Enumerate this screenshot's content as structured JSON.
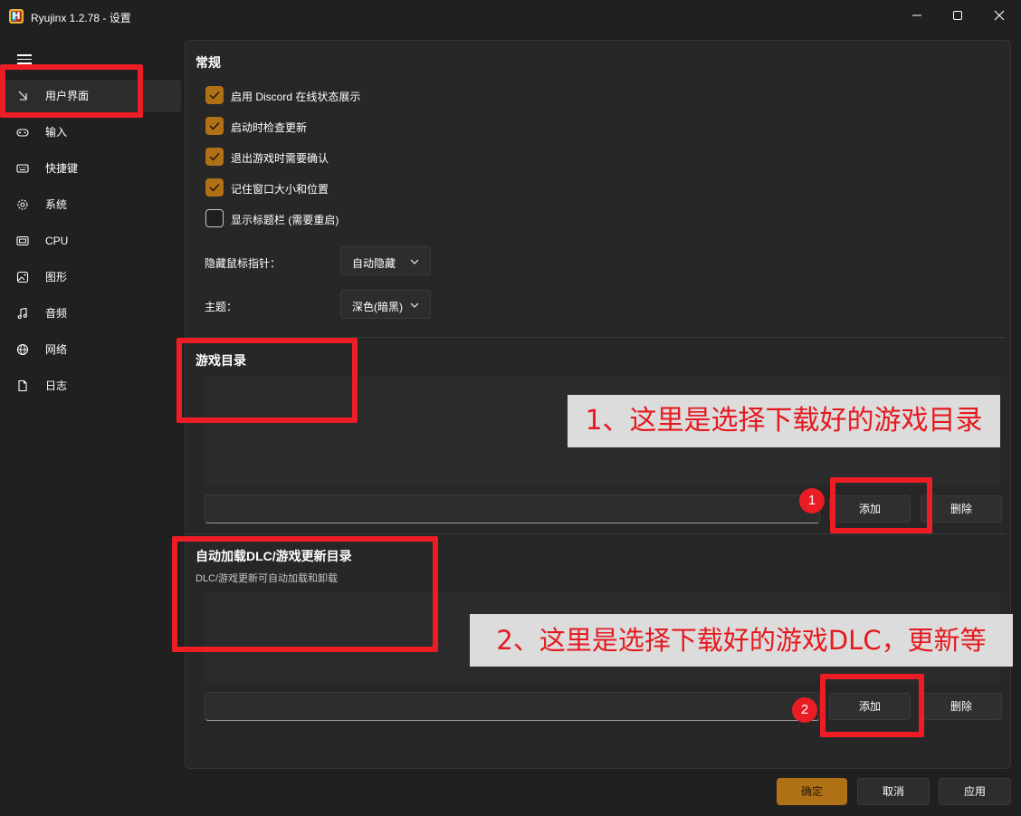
{
  "window": {
    "title": "Ryujinx 1.2.78 - 设置",
    "app_icon_letter": "H"
  },
  "sidebar": {
    "items": [
      {
        "label": "用户界面",
        "icon": "user-interface-icon",
        "active": true
      },
      {
        "label": "输入",
        "icon": "gamepad-icon"
      },
      {
        "label": "快捷键",
        "icon": "keyboard-icon"
      },
      {
        "label": "系统",
        "icon": "gear-icon"
      },
      {
        "label": "CPU",
        "icon": "cpu-icon"
      },
      {
        "label": "图形",
        "icon": "image-icon"
      },
      {
        "label": "音频",
        "icon": "music-note-icon"
      },
      {
        "label": "网络",
        "icon": "globe-icon"
      },
      {
        "label": "日志",
        "icon": "document-icon"
      }
    ]
  },
  "general": {
    "title": "常规",
    "checkboxes": [
      {
        "label": "启用 Discord 在线状态展示",
        "checked": true
      },
      {
        "label": "启动时检查更新",
        "checked": true
      },
      {
        "label": "退出游戏时需要确认",
        "checked": true
      },
      {
        "label": "记住窗口大小和位置",
        "checked": true
      },
      {
        "label": "显示标题栏 (需要重启)",
        "checked": false
      }
    ],
    "hide_cursor": {
      "label": "隐藏鼠标指针：",
      "value": "自动隐藏"
    },
    "theme": {
      "label": "主题：",
      "value": "深色(暗黑)"
    }
  },
  "game_dirs": {
    "title": "游戏目录",
    "input_value": "",
    "add_label": "添加",
    "remove_label": "删除"
  },
  "dlc_dirs": {
    "title": "自动加载DLC/游戏更新目录",
    "subtitle": "DLC/游戏更新可自动加载和卸载",
    "input_value": "",
    "add_label": "添加",
    "remove_label": "删除"
  },
  "footer": {
    "ok_label": "确定",
    "cancel_label": "取消",
    "apply_label": "应用"
  },
  "annotations": {
    "callout_1": "1、这里是选择下载好的游戏目录",
    "callout_2": "2、这里是选择下载好的游戏DLC，更新等",
    "badge_1": "1",
    "badge_2": "2",
    "color": "#ee1c25"
  },
  "colors": {
    "accent": "#b07116",
    "background": "#202020",
    "panel": "#272727"
  }
}
